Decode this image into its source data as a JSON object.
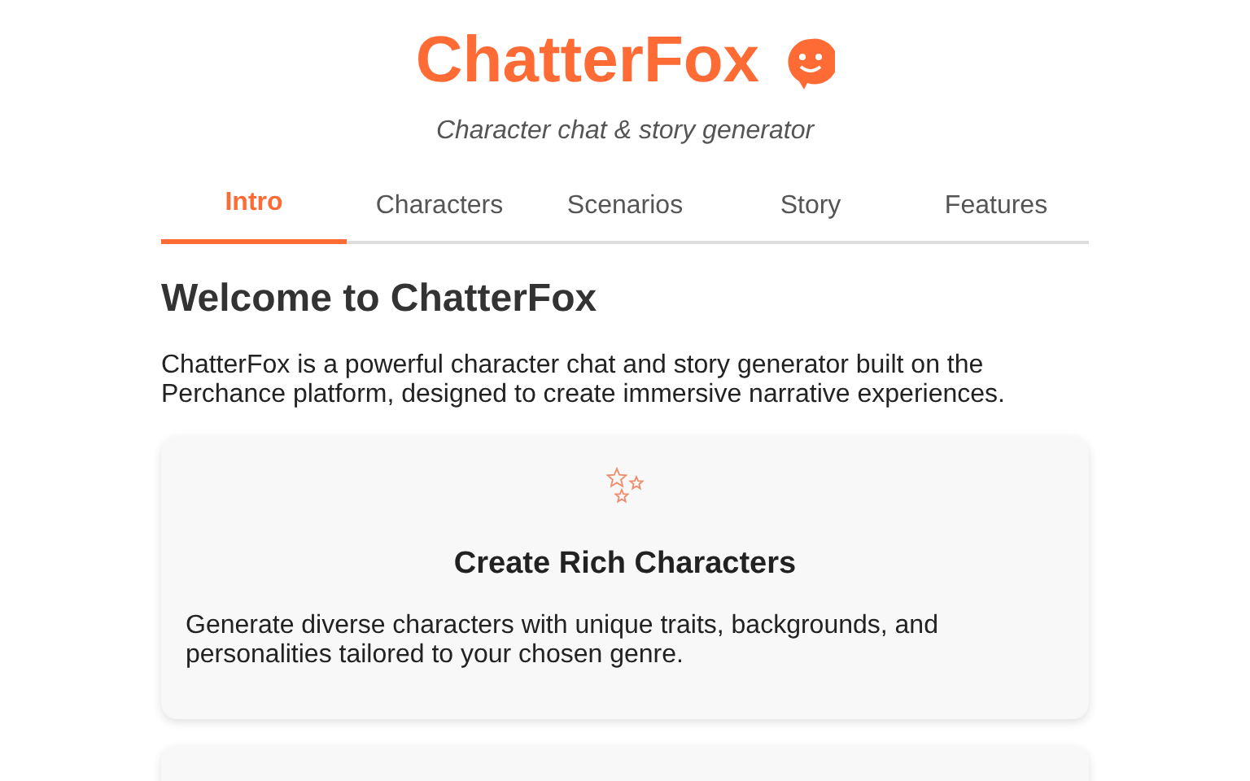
{
  "header": {
    "title": "ChatterFox",
    "subtitle": "Character chat & story generator"
  },
  "tabs": [
    {
      "label": "Intro",
      "selected": true
    },
    {
      "label": "Characters",
      "selected": false
    },
    {
      "label": "Scenarios",
      "selected": false
    },
    {
      "label": "Story",
      "selected": false
    },
    {
      "label": "Features",
      "selected": false
    }
  ],
  "section": {
    "heading": "Welcome to ChatterFox",
    "intro": "ChatterFox is a powerful character chat and story generator built on the Perchance platform, designed to create immersive narrative experiences."
  },
  "cards": [
    {
      "title": "Create Rich Characters",
      "text": "Generate diverse characters with unique traits, backgrounds, and personalities tailored to your chosen genre."
    }
  ]
}
